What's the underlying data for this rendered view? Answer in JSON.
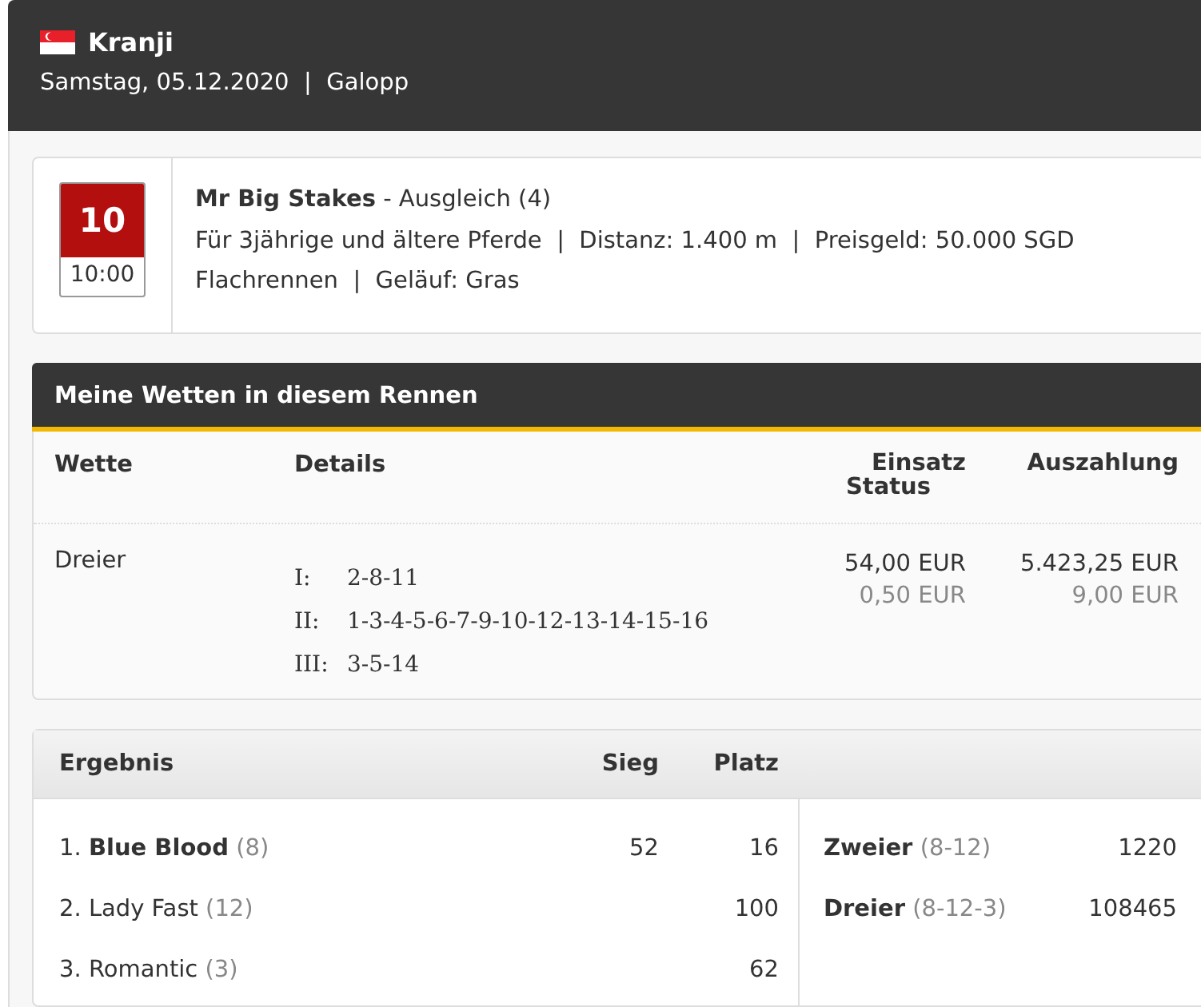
{
  "venue": {
    "name": "Kranji",
    "subtitle": "Samstag, 05.12.2020  |  Galopp"
  },
  "race": {
    "number": "10",
    "time": "10:00",
    "title": "Mr Big Stakes",
    "type": " - Ausgleich (4)",
    "line2": "Für 3jährige und ältere Pferde  |  Distanz: 1.400 m  |  Preisgeld: 50.000 SGD",
    "line3": "Flachrennen  |  Geläuf: Gras"
  },
  "bets": {
    "title": "Meine Wetten in diesem Rennen",
    "columns": [
      "Wette",
      "Details",
      "Einsatz",
      "Status",
      "Auszahlung"
    ],
    "rows": [
      {
        "bet": "Dreier",
        "details": [
          {
            "leg": "I:",
            "numbers": "2-8-11"
          },
          {
            "leg": "II:",
            "numbers": "1-3-4-5-6-7-9-10-12-13-14-15-16"
          },
          {
            "leg": "III:",
            "numbers": "3-5-14"
          }
        ],
        "stake": "54,00 EUR",
        "status": "0,50 EUR",
        "payout": "5.423,25 EUR",
        "payout_sub": "9,00 EUR"
      }
    ]
  },
  "results": {
    "columns": [
      "Ergebnis",
      "Sieg",
      "Platz"
    ],
    "rows": [
      {
        "label": "1. **Blue Blood**",
        "number": "(8)",
        "win": "52",
        "place": "16"
      },
      {
        "label": "2. Lady Fast",
        "number": "(12)",
        "place": "100"
      },
      {
        "label": "3. Romantic",
        "number": "(3)",
        "place": "62"
      }
    ],
    "combos": [
      {
        "name": "Zweier",
        "combo": "(8-12)",
        "quote": "1220"
      },
      {
        "name": "Dreier",
        "combo": "(8-12-3)",
        "quote": "108465"
      }
    ]
  }
}
